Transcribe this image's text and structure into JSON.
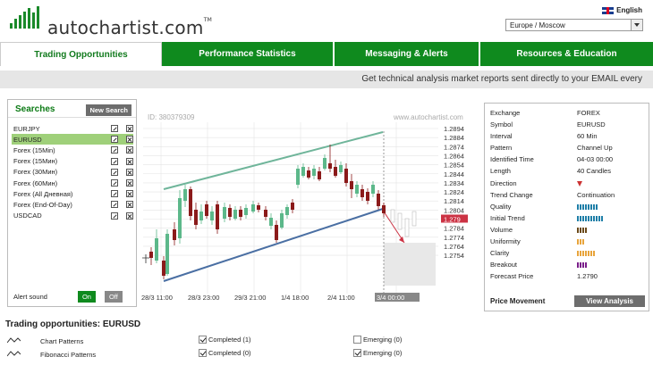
{
  "header": {
    "logo_text": "autochartist.com",
    "logo_tm": "TM",
    "language": "English",
    "timezone": "Europe / Moscow"
  },
  "tabs": [
    {
      "label": "Trading Opportunities",
      "active": true
    },
    {
      "label": "Performance Statistics",
      "active": false
    },
    {
      "label": "Messaging & Alerts",
      "active": false
    },
    {
      "label": "Resources & Education",
      "active": false
    }
  ],
  "banner": "Get technical analysis market reports sent directly to your EMAIL every",
  "searches": {
    "title": "Searches",
    "new_search_label": "New Search",
    "items": [
      {
        "label": "EURJPY",
        "selected": false
      },
      {
        "label": "EURUSD",
        "selected": true
      },
      {
        "label": "Forex (15Min)",
        "selected": false
      },
      {
        "label": "Forex (15Мин)",
        "selected": false
      },
      {
        "label": "Forex (30Мин)",
        "selected": false
      },
      {
        "label": "Forex (60Мин)",
        "selected": false
      },
      {
        "label": "Forex (All Дневная)",
        "selected": false
      },
      {
        "label": "Forex (End-Of-Day)",
        "selected": false
      },
      {
        "label": "USDCAD",
        "selected": false
      }
    ],
    "alert_sound_label": "Alert sound",
    "on_label": "On",
    "off_label": "Off"
  },
  "chart": {
    "id_text": "ID: 380379309",
    "site_text": "www.autochartist.com",
    "price_ticks": [
      "1.2894",
      "1.2884",
      "1.2874",
      "1.2864",
      "1.2854",
      "1.2844",
      "1.2834",
      "1.2824",
      "1.2814",
      "1.2804",
      "1.279",
      "1.2784",
      "1.2774",
      "1.2764",
      "1.2754"
    ],
    "highlighted_price": "1.279",
    "time_ticks": [
      "28/3 11:00",
      "28/3 23:00",
      "29/3 21:00",
      "1/4 18:00",
      "2/4 11:00",
      "3/4 00:00"
    ],
    "colors": {
      "up": "#5cb88a",
      "down": "#8b1a1a",
      "upper_line": "#6fb59a",
      "lower_line": "#4a6fa3",
      "forecast": "#cc3344"
    }
  },
  "info": {
    "rows": [
      {
        "k": "Exchange",
        "v": "FOREX"
      },
      {
        "k": "Symbol",
        "v": "EURUSD"
      },
      {
        "k": "Interval",
        "v": "60 Min"
      },
      {
        "k": "Pattern",
        "v": "Channel Up"
      },
      {
        "k": "Identified Time",
        "v": "04-03 00:00"
      },
      {
        "k": "Length",
        "v": "40 Candles"
      },
      {
        "k": "Direction",
        "v": ""
      },
      {
        "k": "Trend Change",
        "v": "Continuation"
      },
      {
        "k": "Quality",
        "v": ""
      },
      {
        "k": "Initial Trend",
        "v": ""
      },
      {
        "k": "Volume",
        "v": ""
      },
      {
        "k": "Uniformity",
        "v": ""
      },
      {
        "k": "Clarity",
        "v": ""
      },
      {
        "k": "Breakout",
        "v": ""
      },
      {
        "k": "Forecast Price",
        "v": "1.2790"
      }
    ],
    "quality_bars": 8,
    "initial_trend_bars": 10,
    "volume_bars": 4,
    "uniformity_bars": 3,
    "clarity_bars": 7,
    "breakout_bars": 4,
    "bar_colors": {
      "quality": "#1f7fa8",
      "initial_trend": "#1f7fa8",
      "volume": "#6b4a1a",
      "uniformity": "#e8a43b",
      "clarity": "#e8a43b",
      "breakout": "#7a1e8a"
    },
    "direction_icon": "triangle-down-icon",
    "price_movement_label": "Price Movement",
    "view_analysis_label": "View Analysis"
  },
  "opportunities": {
    "title": "Trading opportunities: EURUSD",
    "rows": [
      {
        "name": "Chart Patterns",
        "icon": "chart-pattern-icon",
        "completed": "Completed (1)",
        "completed_checked": true,
        "emerging": "Emerging (0)",
        "emerging_checked": false
      },
      {
        "name": "Fibonacci Patterns",
        "icon": "fibonacci-icon",
        "completed": "Completed (0)",
        "completed_checked": true,
        "emerging": "Emerging (0)",
        "emerging_checked": true
      }
    ]
  }
}
